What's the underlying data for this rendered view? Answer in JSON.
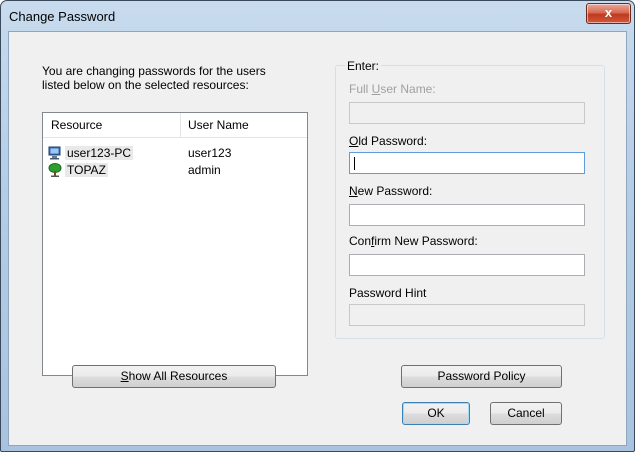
{
  "window": {
    "title": "Change Password",
    "close_label": "x"
  },
  "intro_text": {
    "line1": "You are changing passwords for the users",
    "line2": "listed below on the selected resources:"
  },
  "resources_list": {
    "columns": [
      "Resource",
      "User Name"
    ],
    "rows": [
      {
        "resource": "user123-PC",
        "user": "user123",
        "icon": "computer-icon"
      },
      {
        "resource": "TOPAZ",
        "user": "admin",
        "icon": "domain-tree-icon"
      }
    ]
  },
  "enter_group": {
    "title": "Enter:",
    "full_user_name": {
      "label_pre": "Full ",
      "label_key": "U",
      "label_post": "ser Name:",
      "value": ""
    },
    "old_password": {
      "label_pre": "",
      "label_key": "O",
      "label_post": "ld Password:",
      "value": ""
    },
    "new_password": {
      "label_pre": "",
      "label_key": "N",
      "label_post": "ew Password:",
      "value": ""
    },
    "confirm_password": {
      "label_pre": "Con",
      "label_key": "f",
      "label_post": "irm New Password:",
      "value": ""
    },
    "password_hint": {
      "label": "Password Hint",
      "value": ""
    }
  },
  "buttons": {
    "show_all_pre": "",
    "show_all_key": "S",
    "show_all_post": "how All Resources",
    "password_policy": "Password Policy",
    "ok": "OK",
    "cancel": "Cancel"
  },
  "colors": {
    "titlebar": "#b5cde6",
    "close_button": "#c1391e",
    "dialog_bg": "#f0f0f0"
  }
}
